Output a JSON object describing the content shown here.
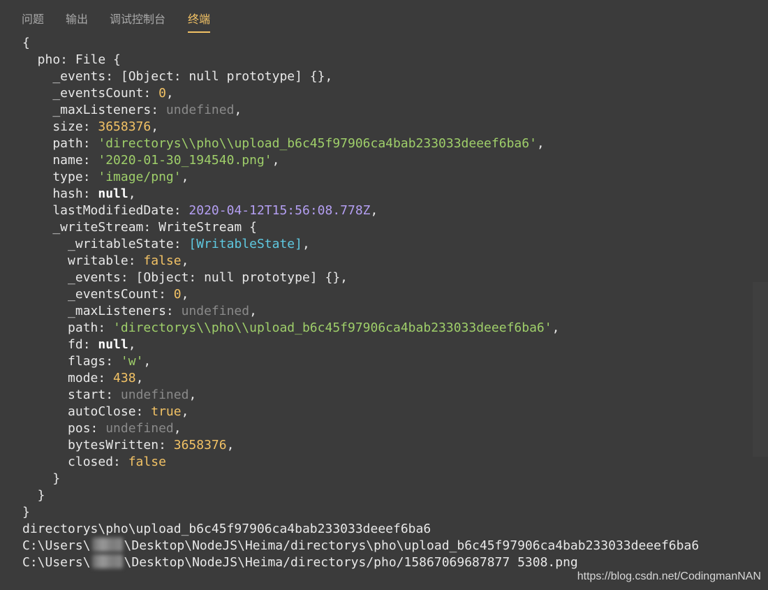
{
  "tabs": [
    {
      "label": "问题",
      "active": false
    },
    {
      "label": "输出",
      "active": false
    },
    {
      "label": "调试控制台",
      "active": false
    },
    {
      "label": "终端",
      "active": true
    }
  ],
  "terminal": {
    "lines": [
      [
        {
          "t": "{"
        }
      ],
      [
        {
          "t": "  pho: File {"
        }
      ],
      [
        {
          "t": "    _events: [Object: null prototype] {},"
        }
      ],
      [
        {
          "t": "    _eventsCount: "
        },
        {
          "t": "0",
          "c": "num"
        },
        {
          "t": ","
        }
      ],
      [
        {
          "t": "    _maxListeners: "
        },
        {
          "t": "undefined",
          "c": "undef"
        },
        {
          "t": ","
        }
      ],
      [
        {
          "t": "    size: "
        },
        {
          "t": "3658376",
          "c": "num"
        },
        {
          "t": ","
        }
      ],
      [
        {
          "t": "    path: "
        },
        {
          "t": "'directorys\\\\pho\\\\upload_b6c45f97906ca4bab233033deeef6ba6'",
          "c": "str"
        },
        {
          "t": ","
        }
      ],
      [
        {
          "t": "    name: "
        },
        {
          "t": "'2020-01-30_194540.png'",
          "c": "str"
        },
        {
          "t": ","
        }
      ],
      [
        {
          "t": "    type: "
        },
        {
          "t": "'image/png'",
          "c": "str"
        },
        {
          "t": ","
        }
      ],
      [
        {
          "t": "    hash: "
        },
        {
          "t": "null",
          "c": "nul"
        },
        {
          "t": ","
        }
      ],
      [
        {
          "t": "    lastModifiedDate: "
        },
        {
          "t": "2020-04-12T15:56:08.778Z",
          "c": "date"
        },
        {
          "t": ","
        }
      ],
      [
        {
          "t": "    _writeStream: WriteStream {"
        }
      ],
      [
        {
          "t": "      _writableState: "
        },
        {
          "t": "[WritableState]",
          "c": "special"
        },
        {
          "t": ","
        }
      ],
      [
        {
          "t": "      writable: "
        },
        {
          "t": "false",
          "c": "bool"
        },
        {
          "t": ","
        }
      ],
      [
        {
          "t": "      _events: [Object: null prototype] {},"
        }
      ],
      [
        {
          "t": "      _eventsCount: "
        },
        {
          "t": "0",
          "c": "num"
        },
        {
          "t": ","
        }
      ],
      [
        {
          "t": "      _maxListeners: "
        },
        {
          "t": "undefined",
          "c": "undef"
        },
        {
          "t": ","
        }
      ],
      [
        {
          "t": "      path: "
        },
        {
          "t": "'directorys\\\\pho\\\\upload_b6c45f97906ca4bab233033deeef6ba6'",
          "c": "str"
        },
        {
          "t": ","
        }
      ],
      [
        {
          "t": "      fd: "
        },
        {
          "t": "null",
          "c": "nul"
        },
        {
          "t": ","
        }
      ],
      [
        {
          "t": "      flags: "
        },
        {
          "t": "'w'",
          "c": "str"
        },
        {
          "t": ","
        }
      ],
      [
        {
          "t": "      mode: "
        },
        {
          "t": "438",
          "c": "num"
        },
        {
          "t": ","
        }
      ],
      [
        {
          "t": "      start: "
        },
        {
          "t": "undefined",
          "c": "undef"
        },
        {
          "t": ","
        }
      ],
      [
        {
          "t": "      autoClose: "
        },
        {
          "t": "true",
          "c": "bool"
        },
        {
          "t": ","
        }
      ],
      [
        {
          "t": "      pos: "
        },
        {
          "t": "undefined",
          "c": "undef"
        },
        {
          "t": ","
        }
      ],
      [
        {
          "t": "      bytesWritten: "
        },
        {
          "t": "3658376",
          "c": "num"
        },
        {
          "t": ","
        }
      ],
      [
        {
          "t": "      closed: "
        },
        {
          "t": "false",
          "c": "bool"
        }
      ],
      [
        {
          "t": "    }"
        }
      ],
      [
        {
          "t": "  }"
        }
      ],
      [
        {
          "t": "}"
        }
      ],
      [
        {
          "t": "directorys\\pho\\upload_b6c45f97906ca4bab233033deeef6ba6"
        }
      ],
      [
        {
          "t": "C:\\Users\\"
        },
        {
          "blur": true
        },
        {
          "t": "\\Desktop\\NodeJS\\Heima/directorys\\pho\\upload_b6c45f97906ca4bab233033deeef6ba6"
        }
      ],
      [
        {
          "t": "C:\\Users\\"
        },
        {
          "blur": true
        },
        {
          "t": "\\Desktop\\NodeJS\\Heima/directorys/pho/15867069687877 5308.png"
        }
      ]
    ]
  },
  "watermark": "https://blog.csdn.net/CodingmanNAN",
  "colors": {
    "background": "#3b3b3b",
    "active_tab": "#f2c265",
    "number": "#f2c265",
    "string": "#9fcf6a",
    "undefined": "#8a8a8a",
    "date": "#b49ff2",
    "special": "#5fc8e0"
  }
}
